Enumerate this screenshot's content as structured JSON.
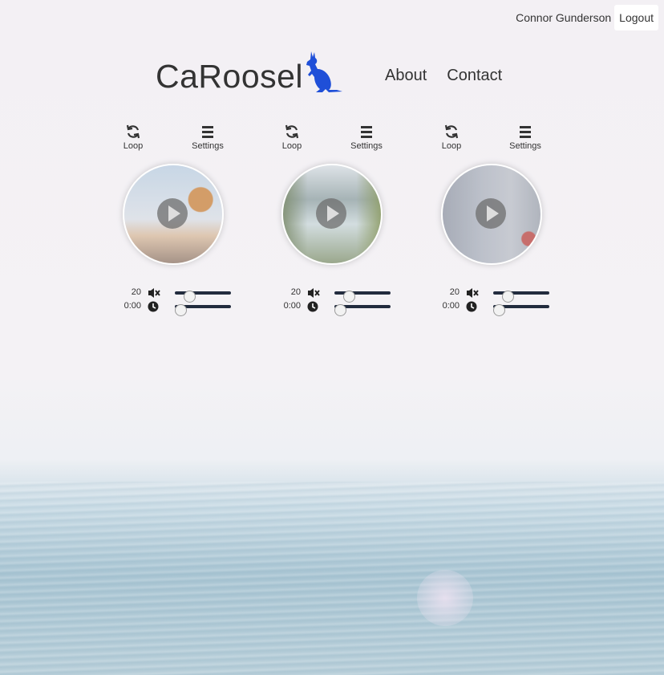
{
  "header": {
    "user_name": "Connor Gunderson",
    "logout_label": "Logout",
    "brand": "CaRoosel",
    "brand_color": "#1f4fd8",
    "nav": [
      "About",
      "Contact"
    ]
  },
  "players": [
    {
      "loop_label": "Loop",
      "settings_label": "Settings",
      "volume": "20",
      "volume_level": 0.2,
      "time": "0:00",
      "time_level": 0.0
    },
    {
      "loop_label": "Loop",
      "settings_label": "Settings",
      "volume": "20",
      "volume_level": 0.2,
      "time": "0:00",
      "time_level": 0.0
    },
    {
      "loop_label": "Loop",
      "settings_label": "Settings",
      "volume": "20",
      "volume_level": 0.2,
      "time": "0:00",
      "time_level": 0.0
    }
  ],
  "icons": [
    "loop-icon",
    "menu-icon",
    "play-icon",
    "mute-icon",
    "clock-icon",
    "kangaroo-logo"
  ]
}
